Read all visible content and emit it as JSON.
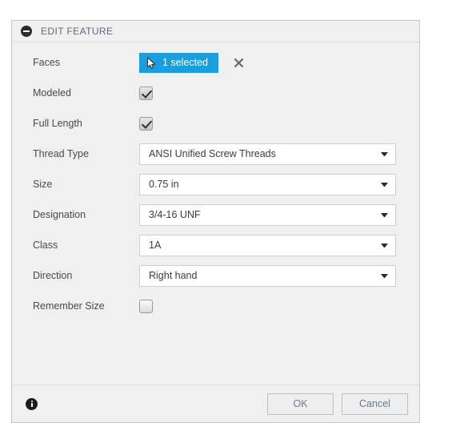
{
  "dialog": {
    "title": "EDIT FEATURE",
    "collapse_icon": "collapse-minus-icon"
  },
  "fields": {
    "faces": {
      "label": "Faces",
      "button_label": "1 selected",
      "button_icon": "cursor-arrow-icon",
      "clear_icon": "close-x-icon",
      "accent_color": "#1a9fdc"
    },
    "modeled": {
      "label": "Modeled",
      "checked": true
    },
    "full_length": {
      "label": "Full Length",
      "checked": true
    },
    "thread_type": {
      "label": "Thread Type",
      "value": "ANSI Unified Screw Threads"
    },
    "size": {
      "label": "Size",
      "value": "0.75 in"
    },
    "designation": {
      "label": "Designation",
      "value": "3/4-16 UNF"
    },
    "class": {
      "label": "Class",
      "value": "1A"
    },
    "direction": {
      "label": "Direction",
      "value": "Right hand"
    },
    "remember_size": {
      "label": "Remember Size",
      "checked": false
    }
  },
  "footer": {
    "info_icon": "info-circle-icon",
    "ok_label": "OK",
    "cancel_label": "Cancel"
  }
}
